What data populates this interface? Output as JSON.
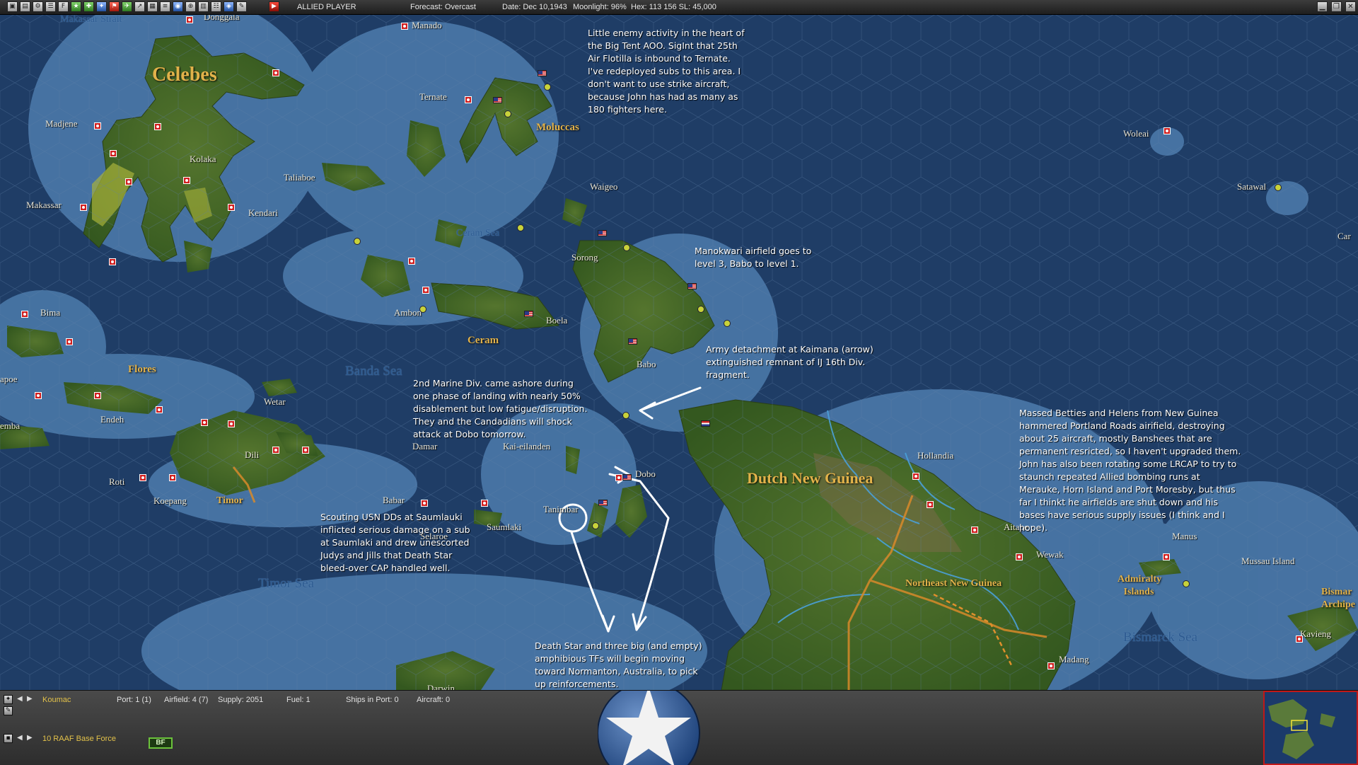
{
  "toolbar": {
    "player": "ALLIED PLAYER",
    "forecast": "Forecast: Overcast",
    "date": "Date: Dec 10,1943",
    "moonlight": "Moonlight: 96%",
    "hex": "Hex: 113 156  SL: 45,000"
  },
  "map": {
    "regions": {
      "celebes": "Celebes",
      "moluccas": "Moluccas",
      "ceram": "Ceram",
      "flores": "Flores",
      "timor": "Timor",
      "dutch_new_guinea": "Dutch New Guinea",
      "northeast_new_guinea": "Northeast New Guinea",
      "admiralty_islands": "Admiralty Islands",
      "bismarck_archipelago": "Bismar Archipe"
    },
    "seas": {
      "banda_sea": "Banda Sea",
      "timor_sea": "Timor Sea",
      "bismarck_sea": "Bismarck Sea",
      "ceram_sea": "Ceram Sea",
      "makassar_strait": "Makassar Strait"
    },
    "places": {
      "donggala": "Donggala",
      "manado": "Manado",
      "madjene": "Madjene",
      "ternate": "Ternate",
      "kolaka": "Kolaka",
      "taliaboe": "Taliaboe",
      "makassar": "Makassar",
      "kendari": "Kendari",
      "waigeo": "Waigeo",
      "sorong": "Sorong",
      "bima": "Bima",
      "ambon": "Ambon",
      "boela": "Boela",
      "babo": "Babo",
      "wetar": "Wetar",
      "endeh": "Endeh",
      "dili": "Dili",
      "damar": "Damar",
      "kai_eilanden": "Kai-eilanden",
      "dobo": "Dobo",
      "roti": "Roti",
      "koepang": "Koepang",
      "babar": "Babar",
      "tanimbar": "Tanimbar",
      "saumlaki": "Saumlaki",
      "selaroe": "Selaroe",
      "hollandia": "Hollandia",
      "aitape": "Aitape",
      "wewak": "Wewak",
      "madang": "Madang",
      "manus": "Manus",
      "mussau_island": "Mussau Island",
      "kavieng": "Kavieng",
      "woleai": "Woleai",
      "satawal": "Satawal",
      "car": "Car",
      "apoe": "apoe",
      "emba": "emba",
      "darwin": "Darwin"
    },
    "notes": {
      "big_tent": "Little enemy activity in the heart of the Big Tent AOO.  SigInt that 25th Air Flotilla is inbound to Ternate. I've redeployed subs to this area.  I don't want to use strike aircraft, because John has had as many as 180 fighters here.",
      "manokwari": "Manokwari airfield goes to level 3, Babo to level 1.",
      "kaimana": "Army detachment at Kaimana (arrow) extinguished remnant of IJ 16th Div. fragment.",
      "marine": "2nd Marine Div. came ashore during one phase of landing with nearly 50% disablement but low fatigue/disruption. They and the Candadians will shock attack at Dobo tomorrow.",
      "betties": "Massed Betties and Helens from New Guinea hammered Portland Roads airifield, destroying about 25 aircraft, mostly Banshees that are permanent resricted, so I haven't upgraded them. John has also been rotating some LRCAP to try to staunch repeated Allied bombing runs at Merauke, Horn Island and Port Moresby, but thus far I thinkt he airfields are shut down and his bases have serious supply issues (I think and I hope).",
      "scouting": "Scouting USN DDs at Saumlauki inflicted serious damage on a sub at Saumlaki and drew unescorted Judys and Jills that Death Star bleed-over CAP handled well.",
      "death_star": "Death Star and three big (and empty) amphibious TFs will begin moving toward Normanton, Australia, to pick up reinforcements."
    }
  },
  "bottom": {
    "base_name": "Koumac",
    "port": "Port: 1 (1)",
    "airfield": "Airfield: 4 (7)",
    "supply": "Supply: 2051",
    "fuel": "Fuel: 1",
    "ships_in_port": "Ships in Port: 0",
    "aircraft": "Aircraft: 0",
    "unit_name": "10 RAAF Base Force",
    "unit_badge": "BF"
  },
  "colors": {
    "deep_sea": "#1f3d66",
    "shallow_sea": "#4a78a8",
    "land": "#3f6a24",
    "japanese_base": "#d12020",
    "region_label": "#e2b24a",
    "annotation": "#ffffff"
  }
}
